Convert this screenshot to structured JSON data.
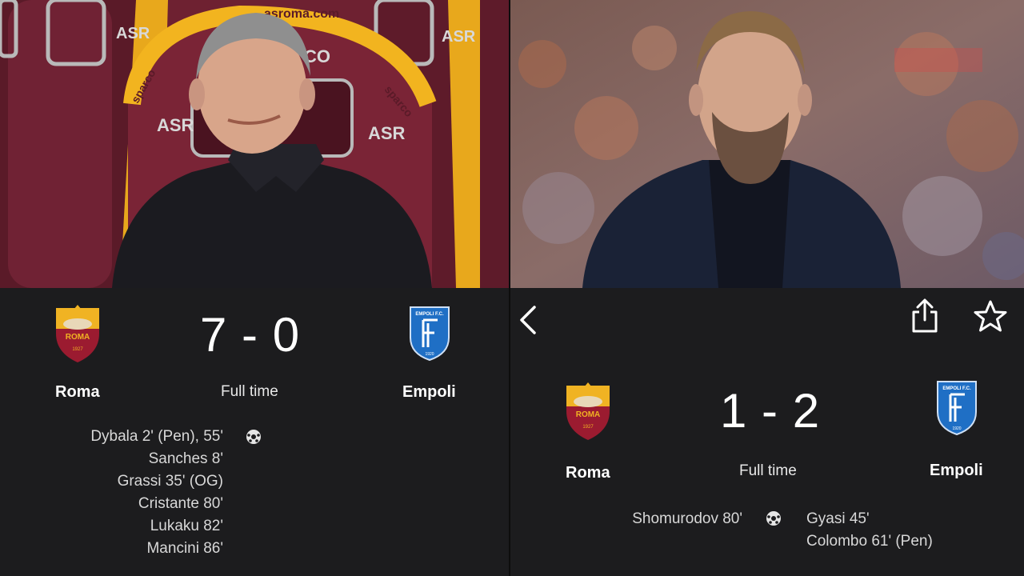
{
  "left": {
    "home_team": "Roma",
    "away_team": "Empoli",
    "score": "7 - 0",
    "status": "Full time",
    "home_scorers": [
      "Dybala  2' (Pen),  55'",
      "Sanches  8'",
      "Grassi  35' (OG)",
      "Cristante  80'",
      "Lukaku  82'",
      "Mancini  86'"
    ],
    "photo_texts": {
      "top_text": "asroma.com",
      "brand": "sparco",
      "logo": "ASR",
      "partial": "CO"
    }
  },
  "right": {
    "home_team": "Roma",
    "away_team": "Empoli",
    "score": "1 - 2",
    "status": "Full time",
    "home_scorers": [
      "Shomurodov  80'"
    ],
    "away_scorers": [
      "Gyasi  45'",
      "Colombo  61' (Pen)"
    ]
  },
  "crests": {
    "roma": {
      "name": "ROMA",
      "year": "1927",
      "colors": {
        "red": "#9b1b30",
        "gold": "#f0b323"
      }
    },
    "empoli": {
      "name": "EMPOLI F.C.",
      "year": "1920",
      "colors": {
        "blue": "#1f6fc5"
      }
    }
  },
  "icons": {
    "back": "chevron-left-icon",
    "share": "share-icon",
    "favorite": "star-icon",
    "goal": "soccer-ball-icon"
  }
}
